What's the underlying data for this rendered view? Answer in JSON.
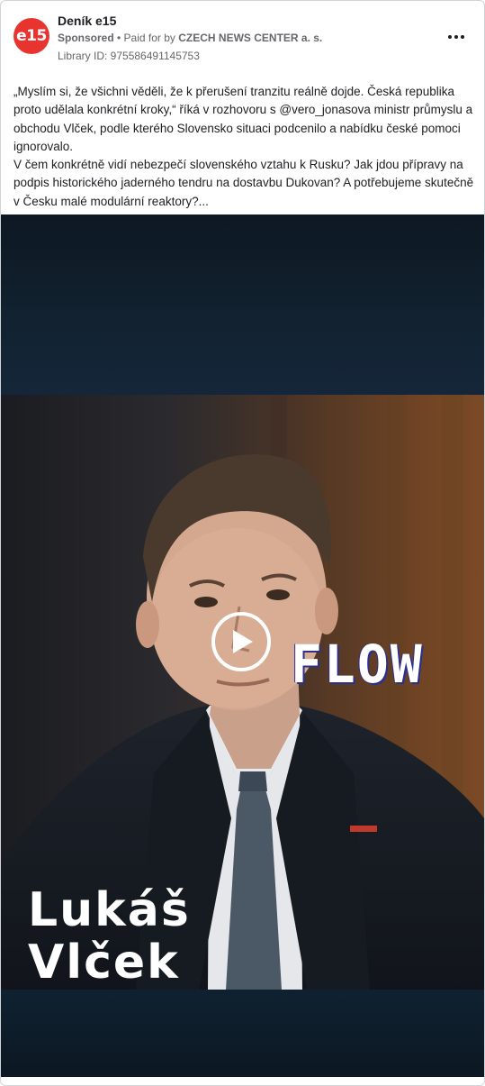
{
  "header": {
    "logo_text": "e15",
    "page_name": "Deník e15",
    "sponsored": "Sponsored",
    "paid_for_prefix": " • Paid for by ",
    "paid_for_org": "CZECH NEWS CENTER a. s.",
    "library_id": "Library ID: 975586491145753",
    "more_icon": "more-horizontal-icon"
  },
  "post": {
    "text": "„Myslím si, že všichni věděli, že k přerušení tranzitu reálně dojde. Česká republika proto udělala konkrétní kroky,“ říká v rozhovoru s @vero_jonasova ministr průmyslu a obchodu Vlček, podle kterého Slovensko situaci podcenilo a nabídku české pomoci ignorovalo.\nV čem konkrétně vidí nebezpečí slovenského vztahu k Rusku? Jak jdou přípravy na podpis historického jaderného tendru na dostavbu Dukovan? A potřebujeme skutečně v Česku malé modulární reaktory?..."
  },
  "video": {
    "show_logo": "FLOW",
    "name_line1": "Lukáš",
    "name_line2": "Vlček",
    "role": "ministr průmyslu a obchodu",
    "play_icon": "play-icon"
  },
  "colors": {
    "brand_red": "#e8332f",
    "meta_gray": "#65676b"
  }
}
